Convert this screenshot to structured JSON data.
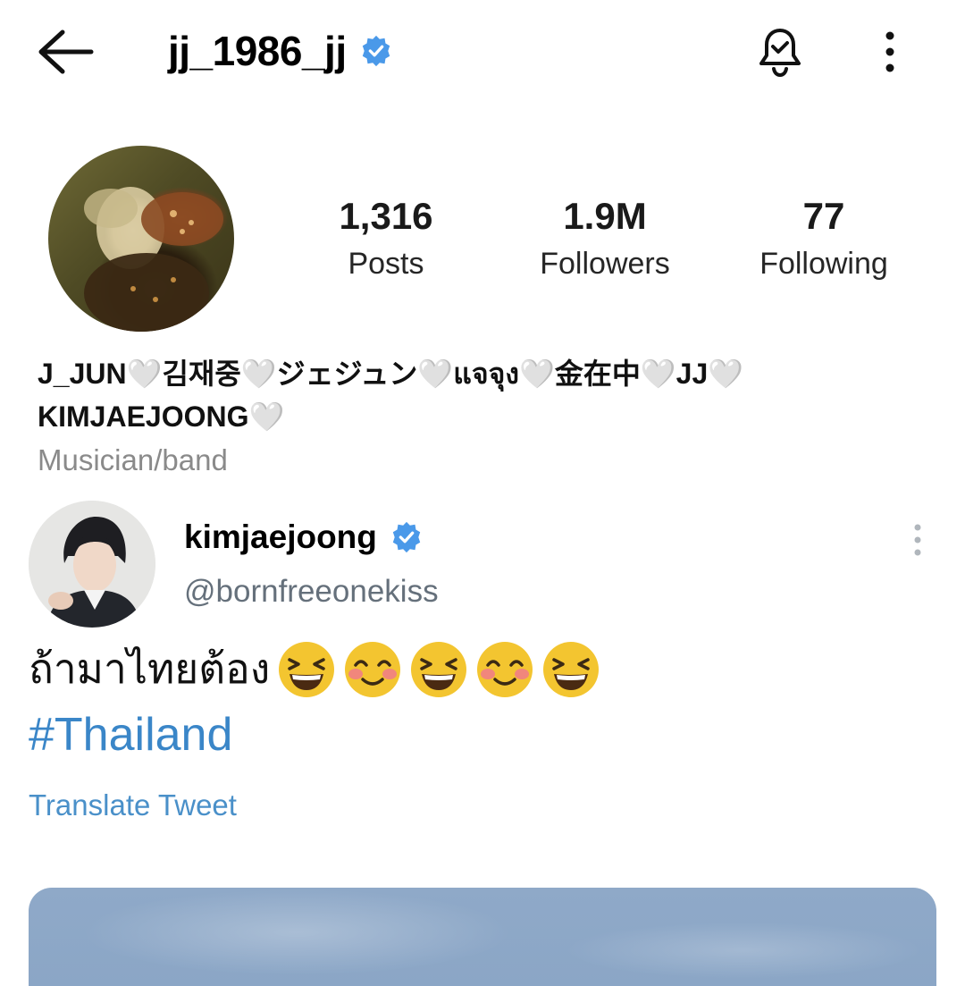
{
  "header": {
    "username": "jj_1986_jj",
    "back_icon": "arrow-left-icon",
    "bell_icon": "bell-icon",
    "more_icon": "more-vertical-icon"
  },
  "profile": {
    "stats": [
      {
        "value": "1,316",
        "label": "Posts"
      },
      {
        "value": "1.9M",
        "label": "Followers"
      },
      {
        "value": "77",
        "label": "Following"
      }
    ],
    "bio_line1": "J_JUN🤍김재중🤍ジェジュン🤍แจจุง🤍金在中🤍JJ🤍",
    "bio_line2": "KIMJAEJOONG🤍",
    "category": "Musician/band"
  },
  "tweet": {
    "display_name": "kimjaejoong",
    "handle": "@bornfreeonekiss",
    "text": "ถ้ามาไทยต้อง",
    "emojis": [
      "laughing",
      "smiling-blush",
      "laughing",
      "smiling-blush",
      "laughing"
    ],
    "hashtag": "#Thailand",
    "translate_label": "Translate Tweet"
  },
  "colors": {
    "verified": "#4a99e9",
    "link": "#3a86c8",
    "muted": "#8a8a8a"
  }
}
